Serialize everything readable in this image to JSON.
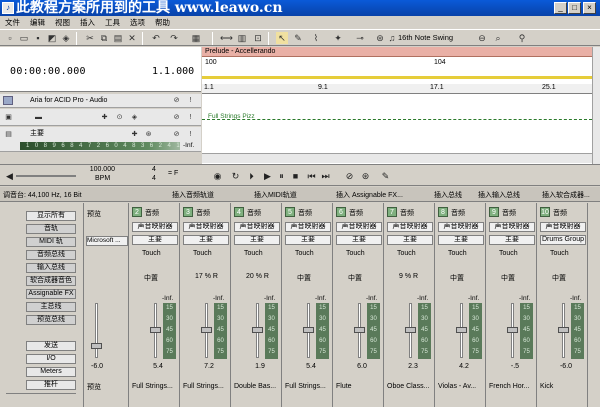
{
  "window": {
    "title": "此教程方案所用到的工具 www.leawo.cn"
  },
  "menu": [
    "文件",
    "编辑",
    "视图",
    "插入",
    "工具",
    "选项",
    "帮助"
  ],
  "toolbar": {
    "swing": "16th Note Swing"
  },
  "time": {
    "timecode": "00:00:00.000",
    "measure": "1.1.000"
  },
  "tracks": [
    {
      "name": "Aria for ACID Pro - Audio"
    },
    {
      "name": "主要",
      "meter": [
        "-Inf.",
        "108",
        "96",
        "84",
        "72",
        "60",
        "48",
        "36",
        "24",
        "12",
        "-Inf."
      ]
    }
  ],
  "timeline": {
    "prelude": "Prelude - Accellerando",
    "marker1": "100",
    "marker2": "104",
    "ruler": [
      "1.1",
      "9.1",
      "17.1",
      "25.1"
    ],
    "region_label": "Full Strings Pizz"
  },
  "transport": {
    "bpm": "100.000",
    "bpm_label": "BPM",
    "beats": "4",
    "beat_unit": "4",
    "key": "= F"
  },
  "mixer": {
    "title": "调音台: 44,100 Hz, 16 Bit",
    "header_buttons": [
      "插入音频轨道",
      "插入MIDI轨道",
      "插入 Assignable FX...",
      "插入总线",
      "插入输入总线",
      "插入软合成器..."
    ],
    "left_buttons": [
      "显示所有",
      "音轨",
      "MIDI 轨",
      "音频总线",
      "输入总线",
      "软合成器音色",
      "Assignable FX",
      "主总线",
      "预览总线"
    ],
    "left_bottom": [
      "发送",
      "I/O",
      "Meters",
      "推杆"
    ],
    "preview": {
      "label": "预览",
      "device": "Microsoft ...",
      "gain": "-6.0",
      "name": "预览"
    },
    "strips": [
      {
        "num": "2",
        "type": "音频",
        "fx": "声音映射器",
        "bus": "主要",
        "touch": "Touch",
        "pan": "中置",
        "inf": "-Inf.",
        "vu": [
          "15",
          "30",
          "45",
          "60",
          "75"
        ],
        "gain": "5.4",
        "name": "Full Strings..."
      },
      {
        "num": "3",
        "type": "音频",
        "fx": "声音映射器",
        "bus": "主要",
        "touch": "Touch",
        "pan": "17 % R",
        "inf": "-Inf.",
        "vu": [
          "15",
          "30",
          "45",
          "60",
          "75"
        ],
        "gain": "7.2",
        "name": "Full Strings..."
      },
      {
        "num": "4",
        "type": "音频",
        "fx": "声音映射器",
        "bus": "主要",
        "touch": "Touch",
        "pan": "20 % R",
        "inf": "-Inf.",
        "vu": [
          "15",
          "30",
          "45",
          "60",
          "75"
        ],
        "gain": "1.9",
        "name": "Double Bas..."
      },
      {
        "num": "5",
        "type": "音频",
        "fx": "声音映射器",
        "bus": "主要",
        "touch": "Touch",
        "pan": "中置",
        "inf": "-Inf.",
        "vu": [
          "15",
          "30",
          "45",
          "60",
          "75"
        ],
        "gain": "5.4",
        "name": "Full Strings..."
      },
      {
        "num": "6",
        "type": "音频",
        "fx": "声音映射器",
        "bus": "主要",
        "touch": "Touch",
        "pan": "中置",
        "inf": "-Inf.",
        "vu": [
          "15",
          "30",
          "45",
          "60",
          "75"
        ],
        "gain": "6.0",
        "name": "Flute"
      },
      {
        "num": "7",
        "type": "音频",
        "fx": "声音映射器",
        "bus": "主要",
        "touch": "Touch",
        "pan": "9 % R",
        "inf": "-Inf.",
        "vu": [
          "15",
          "30",
          "45",
          "60",
          "75"
        ],
        "gain": "2.3",
        "name": "Oboe Class..."
      },
      {
        "num": "8",
        "type": "音频",
        "fx": "声音映射器",
        "bus": "主要",
        "touch": "Touch",
        "pan": "中置",
        "inf": "-Inf.",
        "vu": [
          "15",
          "30",
          "45",
          "60",
          "75"
        ],
        "gain": "4.2",
        "name": "Violas - Av..."
      },
      {
        "num": "9",
        "type": "音频",
        "fx": "声音映射器",
        "bus": "主要",
        "touch": "Touch",
        "pan": "中置",
        "inf": "-Inf.",
        "vu": [
          "15",
          "30",
          "45",
          "60",
          "75"
        ],
        "gain": "-.5",
        "name": "French Hor..."
      },
      {
        "num": "10",
        "type": "音频",
        "fx": "声音映射器",
        "bus": "Drums Group",
        "touch": "Touch",
        "pan": "中置",
        "inf": "-Inf.",
        "vu": [
          "15",
          "30",
          "45",
          "60",
          "75"
        ],
        "gain": "-6.0",
        "name": "Kick"
      }
    ]
  }
}
